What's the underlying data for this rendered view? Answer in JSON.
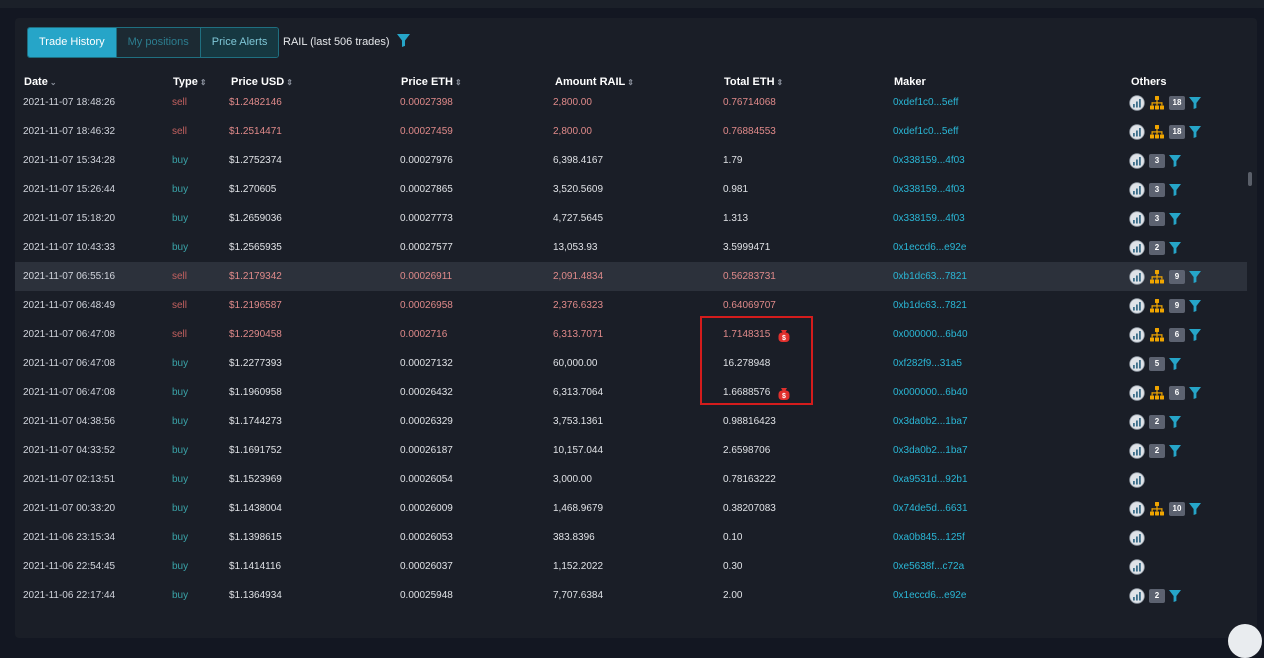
{
  "tabs": [
    {
      "label": "Trade History",
      "active": true
    },
    {
      "label": "My positions",
      "active": false
    },
    {
      "label": "Price Alerts",
      "active": false
    }
  ],
  "title": "RAIL (last 506 trades)",
  "columns": [
    {
      "key": "date",
      "label": "Date",
      "sort": "⌄"
    },
    {
      "key": "type",
      "label": "Type",
      "sort": "⇕"
    },
    {
      "key": "price_usd",
      "label": "Price USD",
      "sort": "⇕"
    },
    {
      "key": "price_eth",
      "label": "Price ETH",
      "sort": "⇕"
    },
    {
      "key": "amount",
      "label": "Amount RAIL",
      "sort": "⇕"
    },
    {
      "key": "total",
      "label": "Total ETH",
      "sort": "⇕"
    },
    {
      "key": "maker",
      "label": "Maker",
      "sort": ""
    },
    {
      "key": "others",
      "label": "Others",
      "sort": ""
    }
  ],
  "colors": {
    "sell": "#c2605f",
    "buy": "#3aa3a8",
    "accent": "#26a5c8",
    "highlight_box": "#d41c1c",
    "network_icon": "#f0a500",
    "whale_icon": "#e0302d"
  },
  "rows": [
    {
      "date": "2021-11-07 18:48:26",
      "type": "sell",
      "usd": "$1.2482146",
      "eth": "0.00027398",
      "amount": "2,800.00",
      "total": "0.76714068",
      "maker": "0xdef1c0...5eff",
      "network": true,
      "badge": "18",
      "filter": true,
      "whale": false,
      "hl": false
    },
    {
      "date": "2021-11-07 18:46:32",
      "type": "sell",
      "usd": "$1.2514471",
      "eth": "0.00027459",
      "amount": "2,800.00",
      "total": "0.76884553",
      "maker": "0xdef1c0...5eff",
      "network": true,
      "badge": "18",
      "filter": true,
      "whale": false,
      "hl": false
    },
    {
      "date": "2021-11-07 15:34:28",
      "type": "buy",
      "usd": "$1.2752374",
      "eth": "0.00027976",
      "amount": "6,398.4167",
      "total": "1.79",
      "maker": "0x338159...4f03",
      "network": false,
      "badge": "3",
      "filter": true,
      "whale": false,
      "hl": false
    },
    {
      "date": "2021-11-07 15:26:44",
      "type": "buy",
      "usd": "$1.270605",
      "eth": "0.00027865",
      "amount": "3,520.5609",
      "total": "0.981",
      "maker": "0x338159...4f03",
      "network": false,
      "badge": "3",
      "filter": true,
      "whale": false,
      "hl": false
    },
    {
      "date": "2021-11-07 15:18:20",
      "type": "buy",
      "usd": "$1.2659036",
      "eth": "0.00027773",
      "amount": "4,727.5645",
      "total": "1.313",
      "maker": "0x338159...4f03",
      "network": false,
      "badge": "3",
      "filter": true,
      "whale": false,
      "hl": false
    },
    {
      "date": "2021-11-07 10:43:33",
      "type": "buy",
      "usd": "$1.2565935",
      "eth": "0.00027577",
      "amount": "13,053.93",
      "total": "3.5999471",
      "maker": "0x1eccd6...e92e",
      "network": false,
      "badge": "2",
      "filter": true,
      "whale": false,
      "hl": false
    },
    {
      "date": "2021-11-07 06:55:16",
      "type": "sell",
      "usd": "$1.2179342",
      "eth": "0.00026911",
      "amount": "2,091.4834",
      "total": "0.56283731",
      "maker": "0xb1dc63...7821",
      "network": true,
      "badge": "9",
      "filter": true,
      "whale": false,
      "hl": true
    },
    {
      "date": "2021-11-07 06:48:49",
      "type": "sell",
      "usd": "$1.2196587",
      "eth": "0.00026958",
      "amount": "2,376.6323",
      "total": "0.64069707",
      "maker": "0xb1dc63...7821",
      "network": true,
      "badge": "9",
      "filter": true,
      "whale": false,
      "hl": false
    },
    {
      "date": "2021-11-07 06:47:08",
      "type": "sell",
      "usd": "$1.2290458",
      "eth": "0.0002716",
      "amount": "6,313.7071",
      "total": "1.7148315",
      "maker": "0x000000...6b40",
      "network": true,
      "badge": "6",
      "filter": true,
      "whale": true,
      "hl": false
    },
    {
      "date": "2021-11-07 06:47:08",
      "type": "buy",
      "usd": "$1.2277393",
      "eth": "0.00027132",
      "amount": "60,000.00",
      "total": "16.278948",
      "maker": "0xf282f9...31a5",
      "network": false,
      "badge": "5",
      "filter": true,
      "whale": false,
      "hl": false
    },
    {
      "date": "2021-11-07 06:47:08",
      "type": "buy",
      "usd": "$1.1960958",
      "eth": "0.00026432",
      "amount": "6,313.7064",
      "total": "1.6688576",
      "maker": "0x000000...6b40",
      "network": true,
      "badge": "6",
      "filter": true,
      "whale": true,
      "hl": false
    },
    {
      "date": "2021-11-07 04:38:56",
      "type": "buy",
      "usd": "$1.1744273",
      "eth": "0.00026329",
      "amount": "3,753.1361",
      "total": "0.98816423",
      "maker": "0x3da0b2...1ba7",
      "network": false,
      "badge": "2",
      "filter": true,
      "whale": false,
      "hl": false
    },
    {
      "date": "2021-11-07 04:33:52",
      "type": "buy",
      "usd": "$1.1691752",
      "eth": "0.00026187",
      "amount": "10,157.044",
      "total": "2.6598706",
      "maker": "0x3da0b2...1ba7",
      "network": false,
      "badge": "2",
      "filter": true,
      "whale": false,
      "hl": false
    },
    {
      "date": "2021-11-07 02:13:51",
      "type": "buy",
      "usd": "$1.1523969",
      "eth": "0.00026054",
      "amount": "3,000.00",
      "total": "0.78163222",
      "maker": "0xa9531d...92b1",
      "network": false,
      "badge": "",
      "filter": false,
      "whale": false,
      "hl": false
    },
    {
      "date": "2021-11-07 00:33:20",
      "type": "buy",
      "usd": "$1.1438004",
      "eth": "0.00026009",
      "amount": "1,468.9679",
      "total": "0.38207083",
      "maker": "0x74de5d...6631",
      "network": true,
      "badge": "10",
      "filter": true,
      "whale": false,
      "hl": false
    },
    {
      "date": "2021-11-06 23:15:34",
      "type": "buy",
      "usd": "$1.1398615",
      "eth": "0.00026053",
      "amount": "383.8396",
      "total": "0.10",
      "maker": "0xa0b845...125f",
      "network": false,
      "badge": "",
      "filter": false,
      "whale": false,
      "hl": false
    },
    {
      "date": "2021-11-06 22:54:45",
      "type": "buy",
      "usd": "$1.1414116",
      "eth": "0.00026037",
      "amount": "1,152.2022",
      "total": "0.30",
      "maker": "0xe5638f...c72a",
      "network": false,
      "badge": "",
      "filter": false,
      "whale": false,
      "hl": false
    },
    {
      "date": "2021-11-06 22:17:44",
      "type": "buy",
      "usd": "$1.1364934",
      "eth": "0.00025948",
      "amount": "7,707.6384",
      "total": "2.00",
      "maker": "0x1eccd6...e92e",
      "network": false,
      "badge": "2",
      "filter": true,
      "whale": false,
      "hl": false
    }
  ]
}
